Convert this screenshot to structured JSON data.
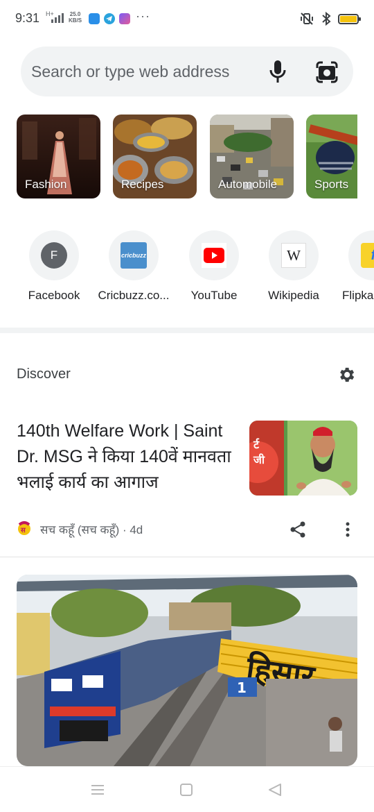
{
  "status_bar": {
    "time": "9:31",
    "network": "H+",
    "speed_value": "25.0",
    "speed_unit": "KB/S",
    "app_icons": [
      "blue-app-icon",
      "telegram-icon",
      "shortcut-app-icon"
    ],
    "more": "···",
    "right_icons": [
      "mute-vibrate-icon",
      "bluetooth-icon",
      "battery-icon"
    ],
    "battery_color": "#f4c20d"
  },
  "search": {
    "placeholder": "Search or type web address",
    "icons": [
      "mic-icon",
      "camera-lens-icon"
    ]
  },
  "topics": [
    {
      "label": "Fashion"
    },
    {
      "label": "Recipes"
    },
    {
      "label": "Automobile"
    },
    {
      "label": "Sports"
    }
  ],
  "shortcuts": [
    {
      "label": "Facebook",
      "letter": "F"
    },
    {
      "label": "Cricbuzz.co...",
      "logo_text": "cricbuzz"
    },
    {
      "label": "YouTube"
    },
    {
      "label": "Wikipedia",
      "logo_text": "W"
    },
    {
      "label": "Flipka"
    }
  ],
  "discover": {
    "title": "Discover",
    "settings_icon": "gear-icon"
  },
  "articles": [
    {
      "title": "140th Welfare Work | Saint Dr. MSG ने किया 140वें मानवता भलाई कार्य का आगाज",
      "source": "सच कहूँ (सच कहूँ) · 4d",
      "thumb_text": "र्ट\nजी"
    },
    {
      "image_sign_text": "हिसार",
      "platform_number": "1"
    }
  ],
  "nav": {
    "buttons": [
      "menu-icon",
      "home-square-icon",
      "back-triangle-icon"
    ]
  },
  "colors": {
    "search_bg": "#f1f3f4",
    "youtube_red": "#ff0000",
    "text_primary": "#202124",
    "text_secondary": "#5f6368"
  }
}
